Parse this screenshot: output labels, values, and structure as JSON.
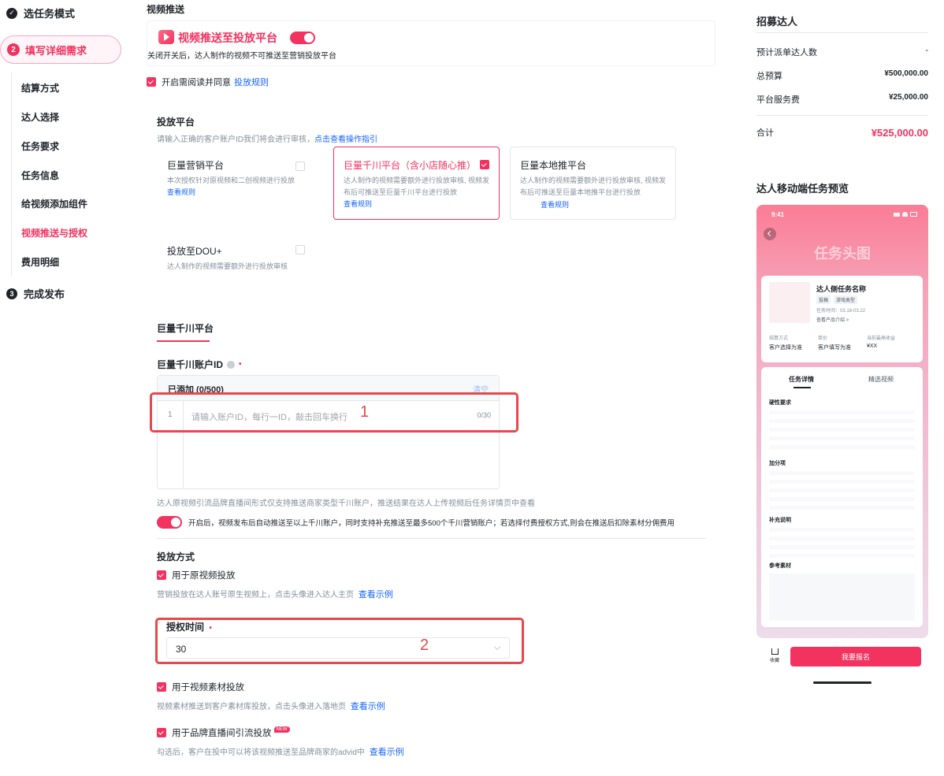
{
  "sidebar": {
    "steps": [
      {
        "num": "✓",
        "label": "选任务模式"
      },
      {
        "num": "2",
        "label": "填写详细需求"
      },
      {
        "num": "3",
        "label": "完成发布"
      }
    ],
    "sub_items": [
      "结算方式",
      "达人选择",
      "任务要求",
      "任务信息",
      "给视频添加组件",
      "视频推送与授权",
      "费用明细"
    ]
  },
  "main": {
    "section_title": "视频推送",
    "push": {
      "title": "视频推送至投放平台",
      "desc": "关闭开关后，达人制作的视频不可推送至营销投放平台",
      "agree_text": "开启需阅读并同意",
      "agree_link": "投放规则"
    },
    "platform": {
      "title": "投放平台",
      "desc": "请输入正确的客户账户ID我们将会进行审核，",
      "desc_link": "点击查看操作指引",
      "cards": [
        {
          "title": "巨量营销平台",
          "desc": "本次授权针对原视频和二创视频进行投放",
          "link": "查看规则",
          "checked": false
        },
        {
          "title": "巨量千川平台（含小店随心推）",
          "desc": "达人制作的视频需要额外进行投放审核, 视频发布后可推送至巨量千川平台进行投放",
          "link": "查看规则",
          "checked": true
        },
        {
          "title": "巨量本地推平台",
          "desc": "达人制作的视频需要额外进行投放审核, 视频发布后可推送至巨量本地推平台进行投放",
          "link": "查看规则",
          "checked": false
        },
        {
          "title": "投放至DOU+",
          "desc": "达人制作的视频需要额外进行投放审核",
          "link": "",
          "checked": false
        }
      ]
    },
    "qianchuan": {
      "tab": "巨量千川平台",
      "id_label": "巨量千川账户ID",
      "added": "已添加 (0/500)",
      "clear": "清空",
      "row_num": "1",
      "placeholder": "请输入账户ID，每行一ID，敲击回车换行",
      "counter": "0/30",
      "note": "达人原视频引流品牌直播间形式仅支持推送商家类型千川账户，推送结果在达人上传视频后任务详情页中查看",
      "auto_push": "开启后，视频发布后自动推送至以上千川账户，同时支持补充推送至最多500个千川营销账户；若选择付费授权方式,则会在推送后扣除素材分佣费用"
    },
    "method": {
      "title": "投放方式",
      "opt1": "用于原视频投放",
      "opt1_desc": "营销投放在达人账号原生视频上，点击头像进入达人主页",
      "opt1_link": "查看示例",
      "auth_label": "授权时间",
      "auth_value": "30",
      "opt2": "用于视频素材投放",
      "opt2_desc": "视频素材推送到客户素材库投放，点击头像进入落地页",
      "opt2_link": "查看示例",
      "opt3": "用于品牌直播间引流投放",
      "opt3_badge": "NEW",
      "opt3_desc": "勾选后，客户在投中可以将该视频推送至品牌商家的advid中",
      "opt3_link": "查看示例"
    },
    "annotations": {
      "box1": "1",
      "box2": "2"
    }
  },
  "right": {
    "recruit_title": "招募达人",
    "rows": [
      {
        "label": "预计派单达人数",
        "value": "-"
      },
      {
        "label": "总预算",
        "value": "¥500,000.00"
      },
      {
        "label": "平台服务费",
        "value": "¥25,000.00"
      }
    ],
    "total_label": "合计",
    "total_value": "¥525,000.00",
    "preview_title": "达人移动端任务预览",
    "phone": {
      "time": "9:41",
      "head": "任务头图",
      "task_name": "达人侧任务名称",
      "tag1": "投稿",
      "tag2": "游戏类型",
      "task_time": "任务时间：03.18-03.22",
      "product_link": "查看产品介绍 >",
      "col1_label": "结算方式",
      "col1_value": "客户选择为准",
      "col2_label": "单价",
      "col2_value": "客户填写为准",
      "col3_label": "当前最高收益",
      "col3_value": "¥XX",
      "tab1": "任务详情",
      "tab2": "精选视频",
      "sec1": "硬性要求",
      "sec2": "加分项",
      "sec3": "补充说明",
      "sec4": "参考素材",
      "fav": "收藏",
      "signup": "我要报名"
    }
  }
}
